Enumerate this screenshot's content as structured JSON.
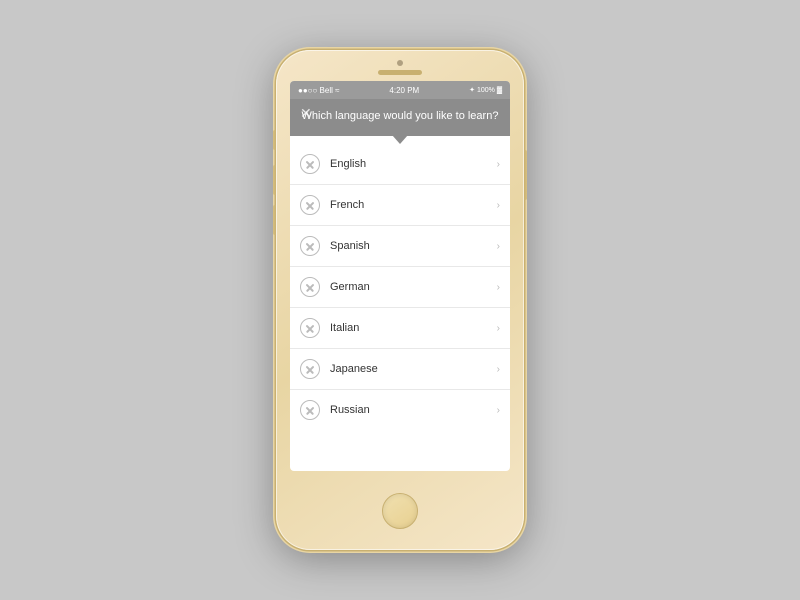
{
  "phone": {
    "status_bar": {
      "carrier": "●●○○ Bell ≈",
      "time": "4:20 PM",
      "battery": "100%"
    },
    "header": {
      "close_label": "✕",
      "title": "Which language would you like to learn?"
    },
    "languages": [
      {
        "name": "English"
      },
      {
        "name": "French"
      },
      {
        "name": "Spanish"
      },
      {
        "name": "German"
      },
      {
        "name": "Italian"
      },
      {
        "name": "Japanese"
      },
      {
        "name": "Russian"
      }
    ]
  }
}
